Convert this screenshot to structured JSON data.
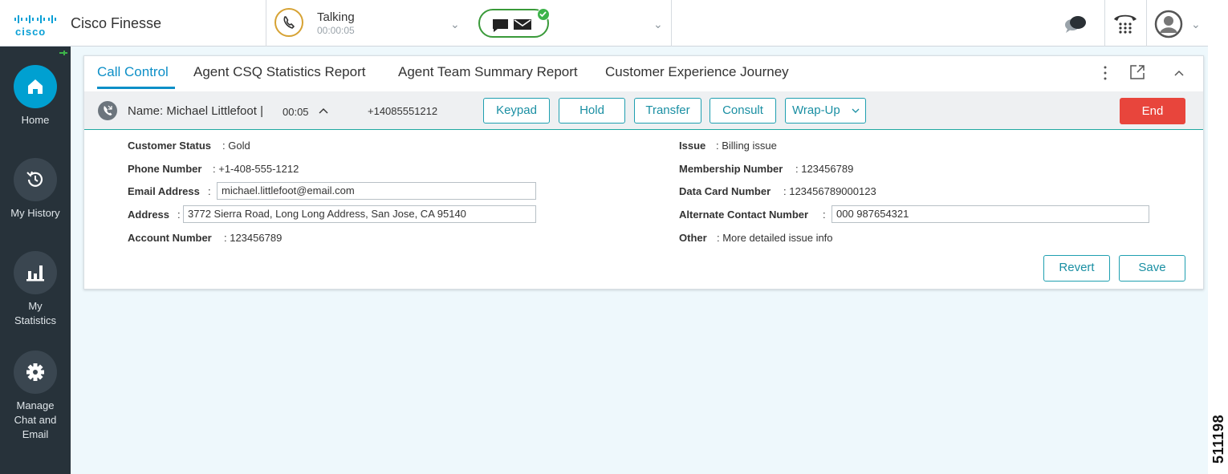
{
  "header": {
    "app_name": "Cisco Finesse",
    "agent_state": "Talking",
    "state_timer": "00:00:05"
  },
  "nav": {
    "items": [
      {
        "label": "Home"
      },
      {
        "label": "My History"
      },
      {
        "label": "My Statistics"
      },
      {
        "label": "Manage Chat and Email"
      }
    ]
  },
  "tabs": [
    {
      "label": "Call Control"
    },
    {
      "label": "Agent CSQ Statistics Report"
    },
    {
      "label": "Agent Team Summary Report"
    },
    {
      "label": "Customer Experience Journey"
    }
  ],
  "call": {
    "caller": "Name: Michael Littlefoot |",
    "duration": "00:05",
    "number": "+14085551212",
    "buttons": {
      "keypad": "Keypad",
      "hold": "Hold",
      "transfer": "Transfer",
      "consult": "Consult",
      "wrapup": "Wrap-Up",
      "end": "End"
    }
  },
  "customer": {
    "left": [
      {
        "label": "Customer Status",
        "value": ": Gold"
      },
      {
        "label": "Phone Number",
        "value": ": +1-408-555-1212"
      },
      {
        "label": "Email Address",
        "value": "michael.littlefoot@email.com"
      },
      {
        "label": "Address",
        "value": "3772 Sierra Road, Long Long Address, San Jose, CA 95140"
      },
      {
        "label": "Account Number",
        "value": ": 123456789"
      }
    ],
    "right": [
      {
        "label": "Issue",
        "value": ": Billing issue"
      },
      {
        "label": "Membership Number",
        "value": ": 123456789"
      },
      {
        "label": "Data Card Number",
        "value": ": 123456789000123"
      },
      {
        "label": "Alternate Contact Number",
        "value": "000 987654321"
      },
      {
        "label": "Other",
        "value": ": More detailed issue info"
      }
    ],
    "revert_label": "Revert",
    "save_label": "Save"
  },
  "figure_id": "511198",
  "colors": {
    "accent": "#0d8fc7",
    "end": "#e8453c",
    "talking": "#d6a233",
    "ready": "#3a9a3a",
    "nav_bg": "#27323a"
  }
}
